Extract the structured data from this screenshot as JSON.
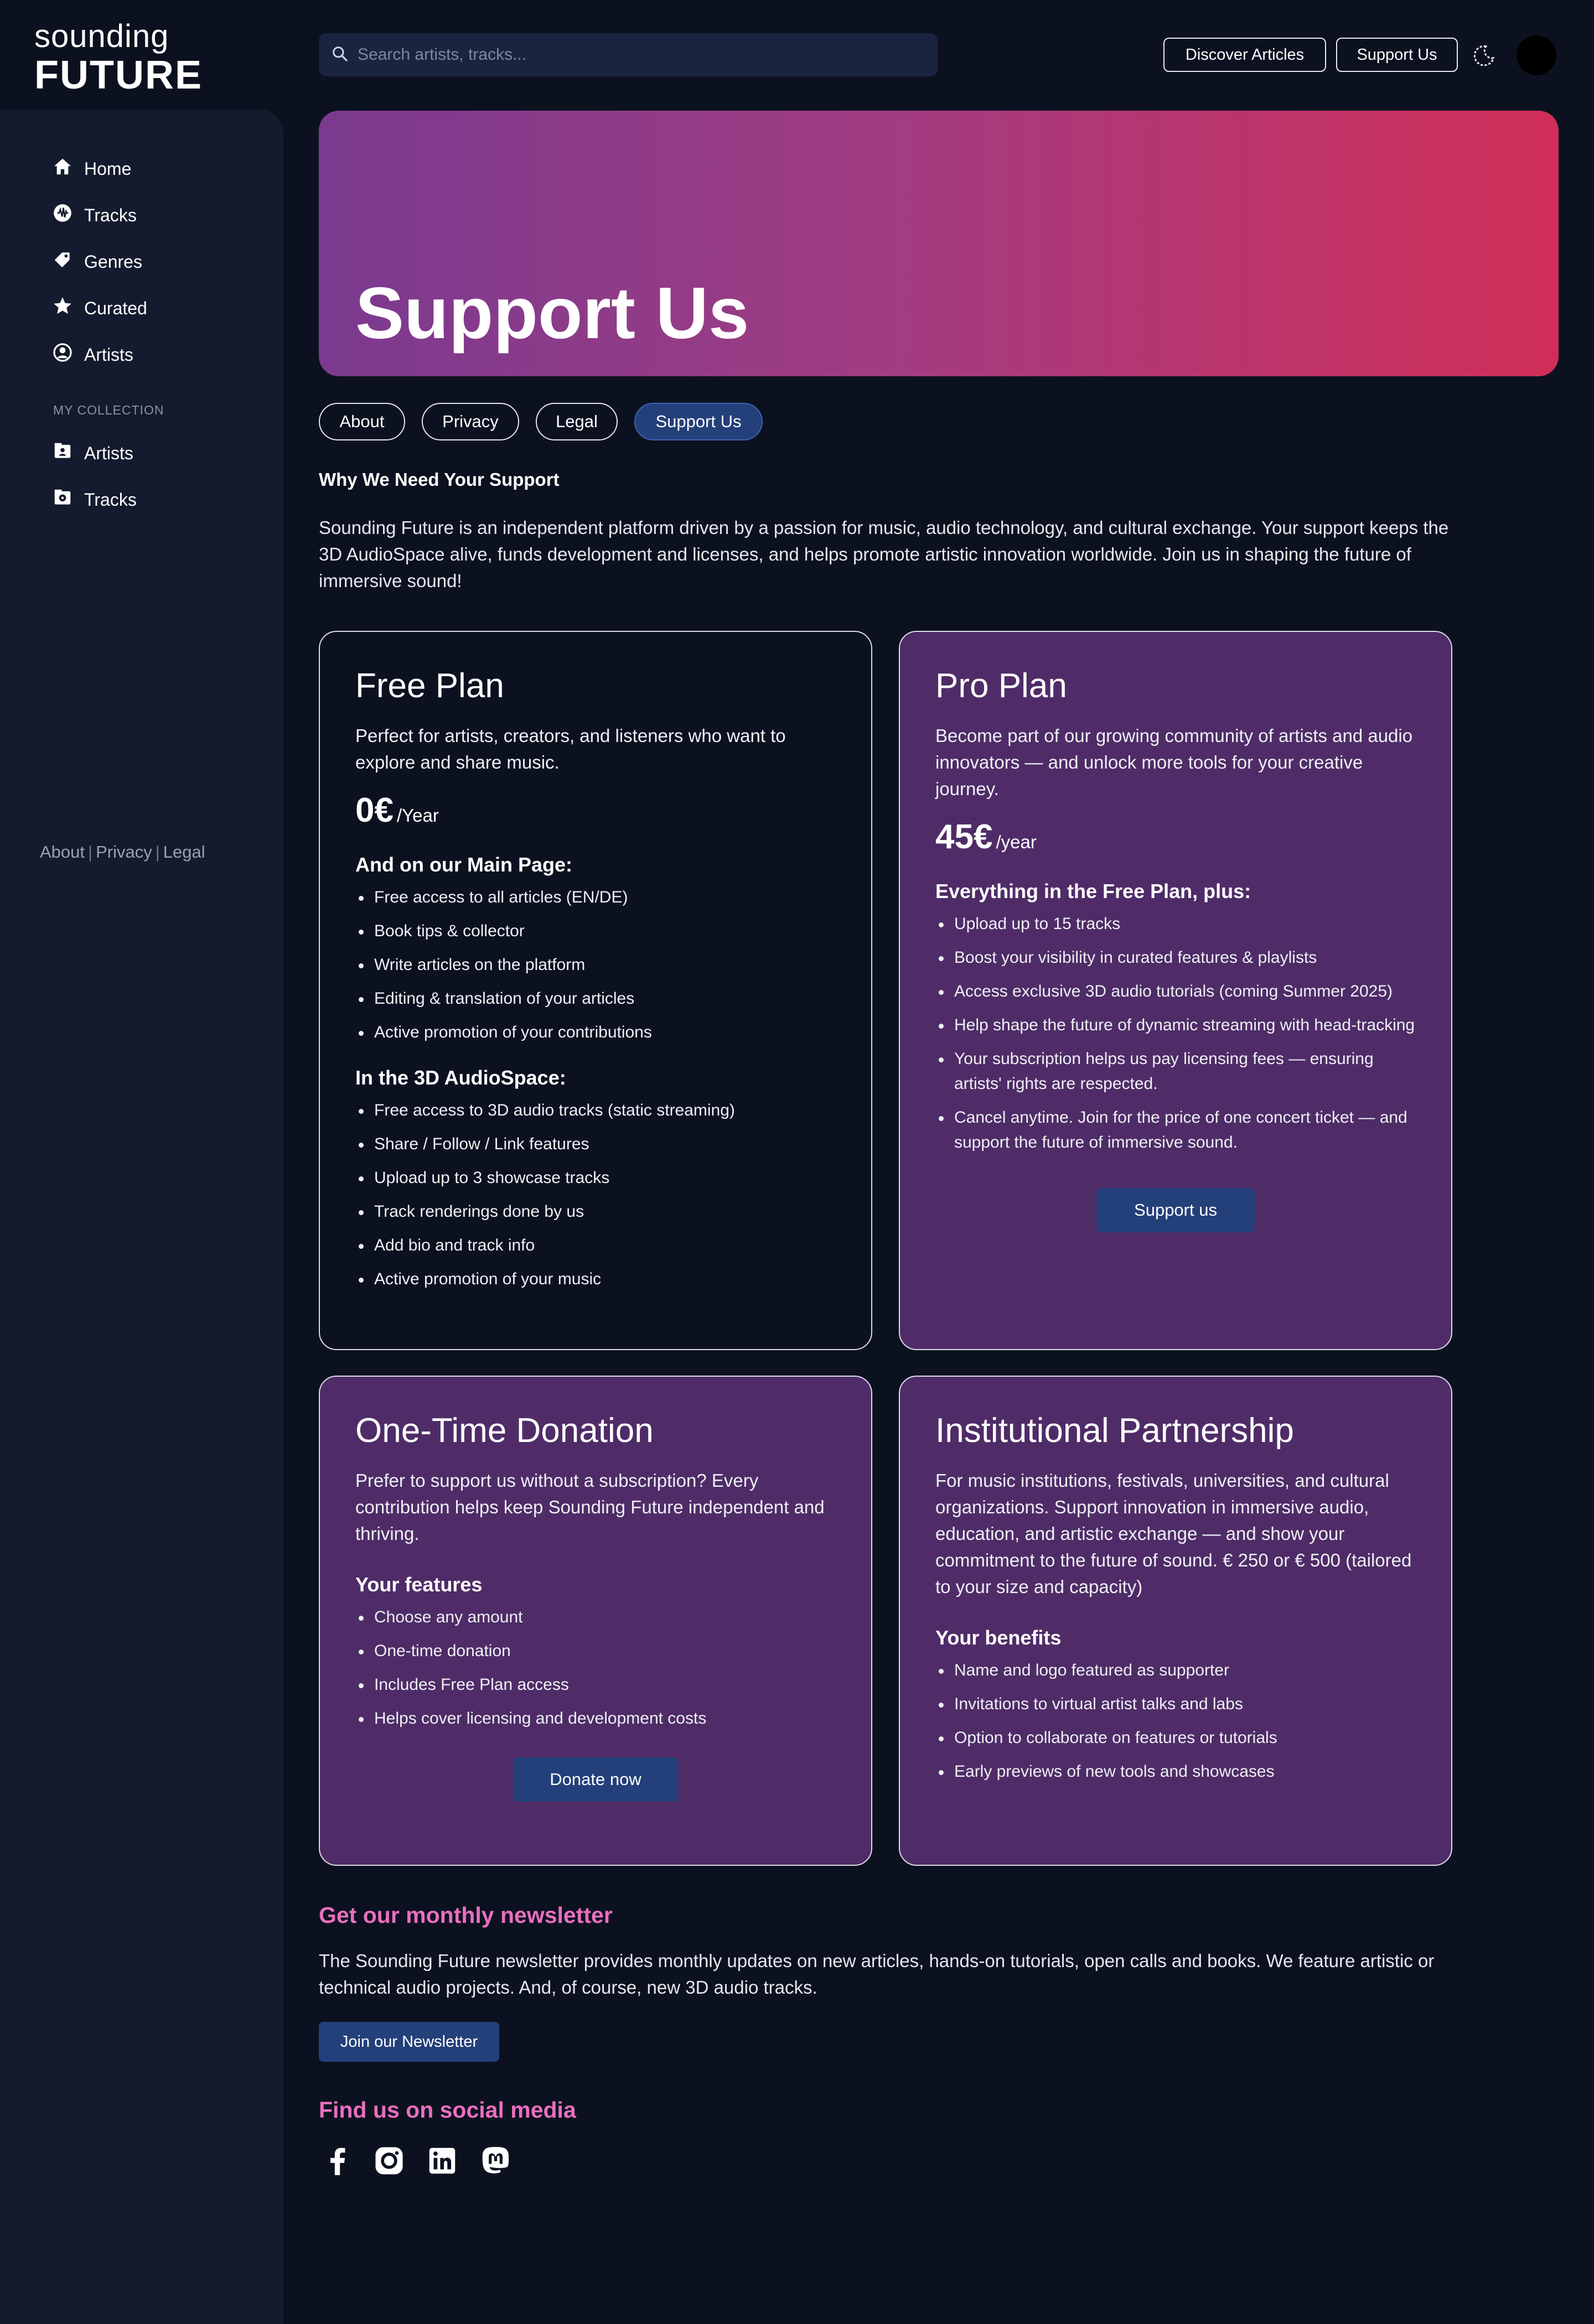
{
  "logo": {
    "line1": "sounding",
    "line2": "FUTURE"
  },
  "search": {
    "placeholder": "Search artists, tracks..."
  },
  "header": {
    "discover_label": "Discover Articles",
    "support_label": "Support Us"
  },
  "sidebar": {
    "items": [
      {
        "label": "Home",
        "icon": "home-icon"
      },
      {
        "label": "Tracks",
        "icon": "waveform-icon"
      },
      {
        "label": "Genres",
        "icon": "tag-icon"
      },
      {
        "label": "Curated",
        "icon": "star-icon"
      },
      {
        "label": "Artists",
        "icon": "user-circle-icon"
      }
    ],
    "collection_label": "MY COLLECTION",
    "collection_items": [
      {
        "label": "Artists",
        "icon": "artist-folder-icon"
      },
      {
        "label": "Tracks",
        "icon": "track-folder-icon"
      }
    ],
    "footer": {
      "about": "About",
      "privacy": "Privacy",
      "legal": "Legal"
    }
  },
  "hero": {
    "title": "Support Us",
    "gradient": [
      "#7a3a8f",
      "#d02e58"
    ]
  },
  "tabs": [
    {
      "label": "About"
    },
    {
      "label": "Privacy"
    },
    {
      "label": "Legal"
    },
    {
      "label": "Support Us",
      "active": true
    }
  ],
  "intro": {
    "title": "Why We Need Your Support",
    "text": "Sounding Future is an independent platform driven by a passion for music, audio technology, and cultural exchange. Your support keeps the 3D AudioSpace alive, funds development and licenses, and helps promote artistic innovation worldwide. Join us in shaping the future of immersive sound!"
  },
  "free_plan": {
    "title": "Free Plan",
    "desc": "Perfect for artists, creators, and listeners who want to explore and share music.",
    "price": "0€",
    "period": "/Year",
    "main_heading": "And on our Main Page:",
    "main_items": [
      "Free access to all articles (EN/DE)",
      "Book tips & collector",
      "Write articles on the platform",
      "Editing & translation of your articles",
      "Active promotion of your contributions"
    ],
    "space_heading": "In the 3D AudioSpace:",
    "space_items": [
      "Free access to 3D audio tracks (static streaming)",
      "Share / Follow / Link features",
      "Upload up to 3 showcase tracks",
      "Track renderings done by us",
      "Add bio and track info",
      "Active promotion of your music"
    ]
  },
  "pro_plan": {
    "title": "Pro Plan",
    "desc": "Become part of our growing community of artists and audio innovators — and unlock more tools for your creative journey.",
    "price": "45€",
    "period": "/year",
    "heading": "Everything in the Free Plan, plus:",
    "items": [
      "Upload up to 15 tracks",
      "Boost your visibility in curated features & playlists",
      "Access exclusive 3D audio tutorials (coming Summer 2025)",
      "Help shape the future of dynamic streaming with head-tracking",
      "Your subscription helps us pay licensing fees — ensuring artists' rights are respected.",
      "Cancel anytime. Join for the price of one concert ticket — and support the future of immersive sound."
    ],
    "cta": "Support us"
  },
  "donation": {
    "title": "One-Time Donation",
    "desc": "Prefer to support us without a subscription? Every contribution helps keep Sounding Future independent and thriving.",
    "heading": "Your features",
    "items": [
      "Choose any amount",
      "One-time donation",
      "Includes Free Plan access",
      "Helps cover licensing and development costs"
    ],
    "cta": "Donate now"
  },
  "partnership": {
    "title": "Institutional Partnership",
    "desc": "For music institutions, festivals, universities, and cultural organizations. Support innovation in immersive audio, education, and artistic exchange — and show your commitment to the future of sound. € 250 or € 500 (tailored to your size and capacity)",
    "heading": "Your benefits",
    "items": [
      "Name and logo featured as supporter",
      "Invitations to virtual artist talks and labs",
      "Option to collaborate on features or tutorials",
      "Early previews of new tools and showcases"
    ]
  },
  "newsletter": {
    "title": "Get our monthly newsletter",
    "text": "The Sounding Future newsletter provides monthly updates on new articles, hands-on tutorials, open calls and books. We feature artistic or technical audio projects. And, of course, new 3D audio tracks.",
    "cta": "Join our Newsletter"
  },
  "social": {
    "title": "Find us on social media",
    "icons": [
      "facebook-icon",
      "instagram-icon",
      "linkedin-icon",
      "mastodon-icon"
    ]
  },
  "colors": {
    "accent_pink": "#e86fbf",
    "button_blue": "#24407a",
    "card_purple": "#4f2c67",
    "background": "#0c1120"
  }
}
